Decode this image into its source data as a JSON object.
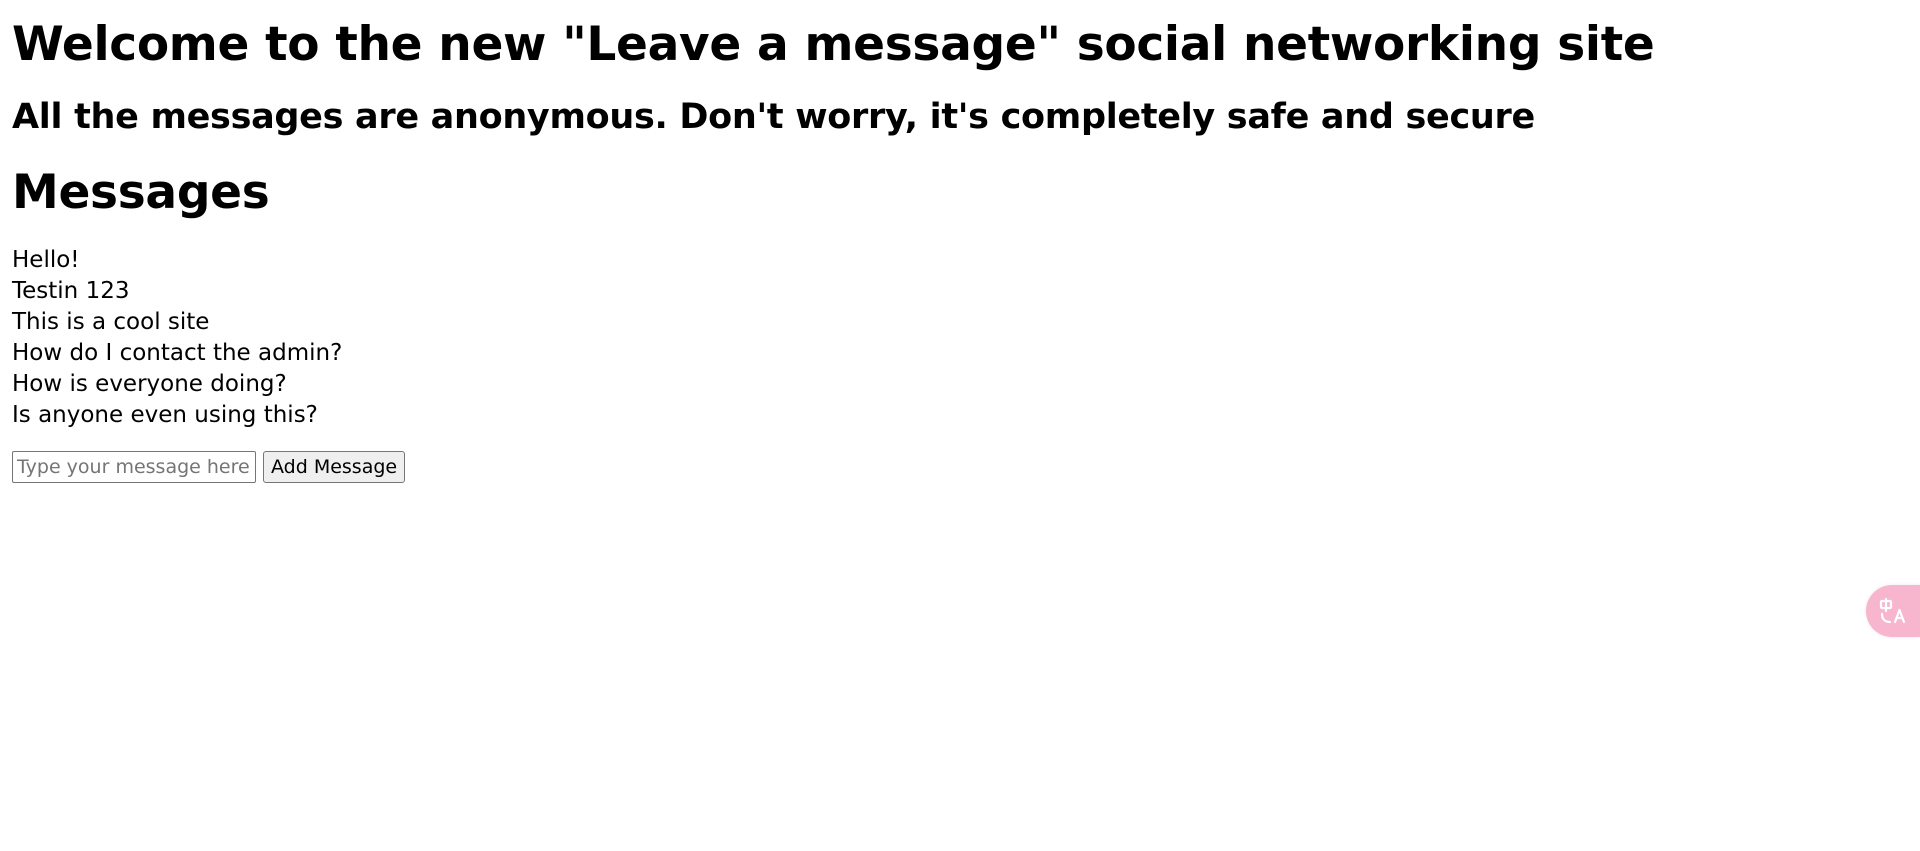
{
  "header": {
    "title": "Welcome to the new \"Leave a message\" social networking site",
    "subtitle": "All the messages are anonymous. Don't worry, it's completely safe and secure"
  },
  "messages": {
    "heading": "Messages",
    "items": [
      "Hello!",
      "Testin 123",
      "This is a cool site",
      "How do I contact the admin?",
      "How is everyone doing?",
      "Is anyone even using this?"
    ]
  },
  "composer": {
    "input_value": "",
    "placeholder": "Type your message here...",
    "button_label": "Add Message"
  },
  "widgets": {
    "translate_icon": "translate-icon",
    "translate_color": "#f7b6cd"
  }
}
